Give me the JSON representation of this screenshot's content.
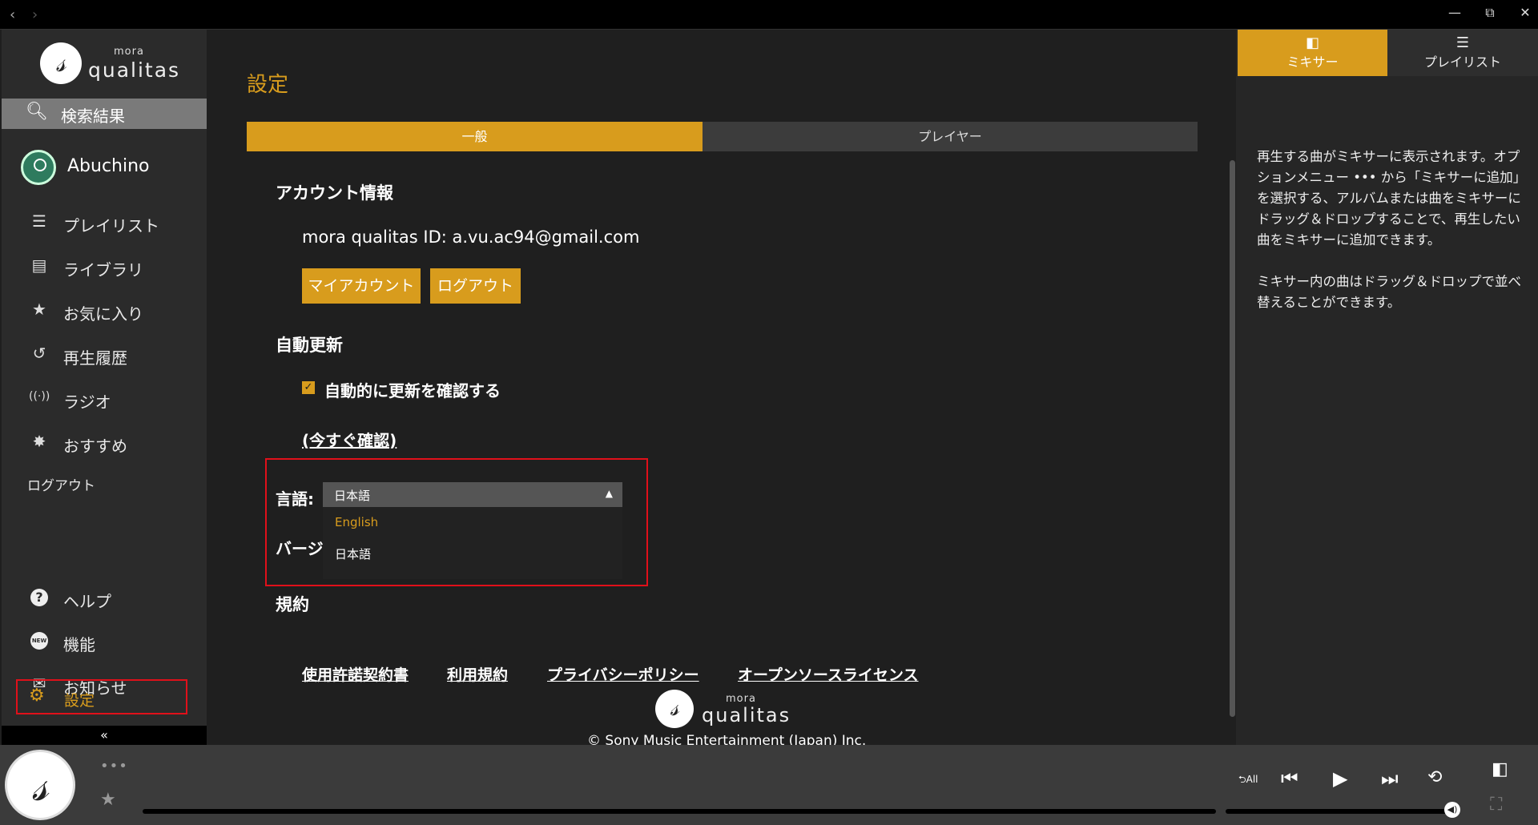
{
  "titlebar": {
    "back": "‹",
    "forward": "›",
    "minimize": "—",
    "restore": "⧉",
    "close": "✕"
  },
  "app": {
    "logo_mora": "mora",
    "logo_name": "qualitas",
    "logo_glyph": "𝓈"
  },
  "sidebar": {
    "search": {
      "icon": "search-icon",
      "label": "検索結果"
    },
    "user": {
      "name": "Abuchino"
    },
    "items": [
      {
        "icon": "playlist-icon",
        "glyph": "☰",
        "label": "プレイリスト"
      },
      {
        "icon": "library-icon",
        "glyph": "▤",
        "label": "ライブラリ"
      },
      {
        "icon": "star-icon",
        "glyph": "★",
        "label": "お気に入り"
      },
      {
        "icon": "history-icon",
        "glyph": "↺",
        "label": "再生履歴"
      },
      {
        "icon": "radio-icon",
        "glyph": "((·))",
        "label": "ラジオ"
      },
      {
        "icon": "recommend-icon",
        "glyph": "✸",
        "label": "おすすめ"
      }
    ],
    "logout": "ログアウト",
    "bottom_items": [
      {
        "icon": "help-icon",
        "glyph": "?",
        "label": "ヘルプ"
      },
      {
        "icon": "new-features-icon",
        "glyph": "NEW",
        "label": "機能"
      },
      {
        "icon": "mail-icon",
        "glyph": "✉",
        "label": "お知らせ"
      }
    ],
    "settings": {
      "icon": "gear-icon",
      "glyph": "⚙",
      "label": "設定"
    },
    "collapse": "«"
  },
  "main": {
    "title": "設定",
    "tabs": [
      {
        "label": "一般",
        "active": true
      },
      {
        "label": "プレイヤー",
        "active": false
      }
    ],
    "account": {
      "heading": "アカウント情報",
      "id_text": "mora qualitas ID: a.vu.ac94@gmail.com",
      "my_account_button": "マイアカウント",
      "logout_button": "ログアウト"
    },
    "auto_update": {
      "heading": "自動更新",
      "checkbox_label": "自動的に更新を確認する",
      "checked": true,
      "check_now": "(今すぐ確認)"
    },
    "language": {
      "label": "言語:",
      "selected": "日本語",
      "options": [
        "English",
        "日本語"
      ],
      "highlighted_option": "English"
    },
    "version": {
      "label": "バージ"
    },
    "terms": {
      "heading": "規約",
      "links": [
        "使用許諾契約書",
        "利用規約",
        "プライバシーポリシー",
        "オープンソースライセンス"
      ]
    },
    "footer": {
      "logo_mora": "mora",
      "logo_name": "qualitas",
      "copyright": "© Sony Music Entertainment (Japan) Inc."
    }
  },
  "right_panel": {
    "tabs": [
      {
        "icon": "mixer-icon",
        "glyph": "◧",
        "label": "ミキサー",
        "active": true
      },
      {
        "icon": "playlist-icon",
        "glyph": "☰",
        "label": "プレイリスト",
        "active": false
      }
    ],
    "paragraphs": [
      "再生する曲がミキサーに表示されます。オプションメニュー ••• から「ミキサーに追加」を選択する、アルバムまたは曲をミキサーにドラッグ＆ドロップすることで、再生したい曲をミキサーに追加できます。",
      "ミキサー内の曲はドラッグ＆ドロップで並べ替えることができます。"
    ]
  },
  "player": {
    "more": "•••",
    "favorite": "★",
    "controls": {
      "repeat_all": "⮌All",
      "previous": "⏮",
      "play": "▶",
      "next": "⏭",
      "shuffle": "⟲",
      "mixer": "◧",
      "fullscreen": "⛶"
    },
    "volume_icon": "🔊"
  },
  "colors": {
    "accent": "#d89c1d",
    "highlight_box": "#e0101a",
    "sidebar_bg": "#2b2b2b",
    "main_bg": "#1f1f1f"
  }
}
